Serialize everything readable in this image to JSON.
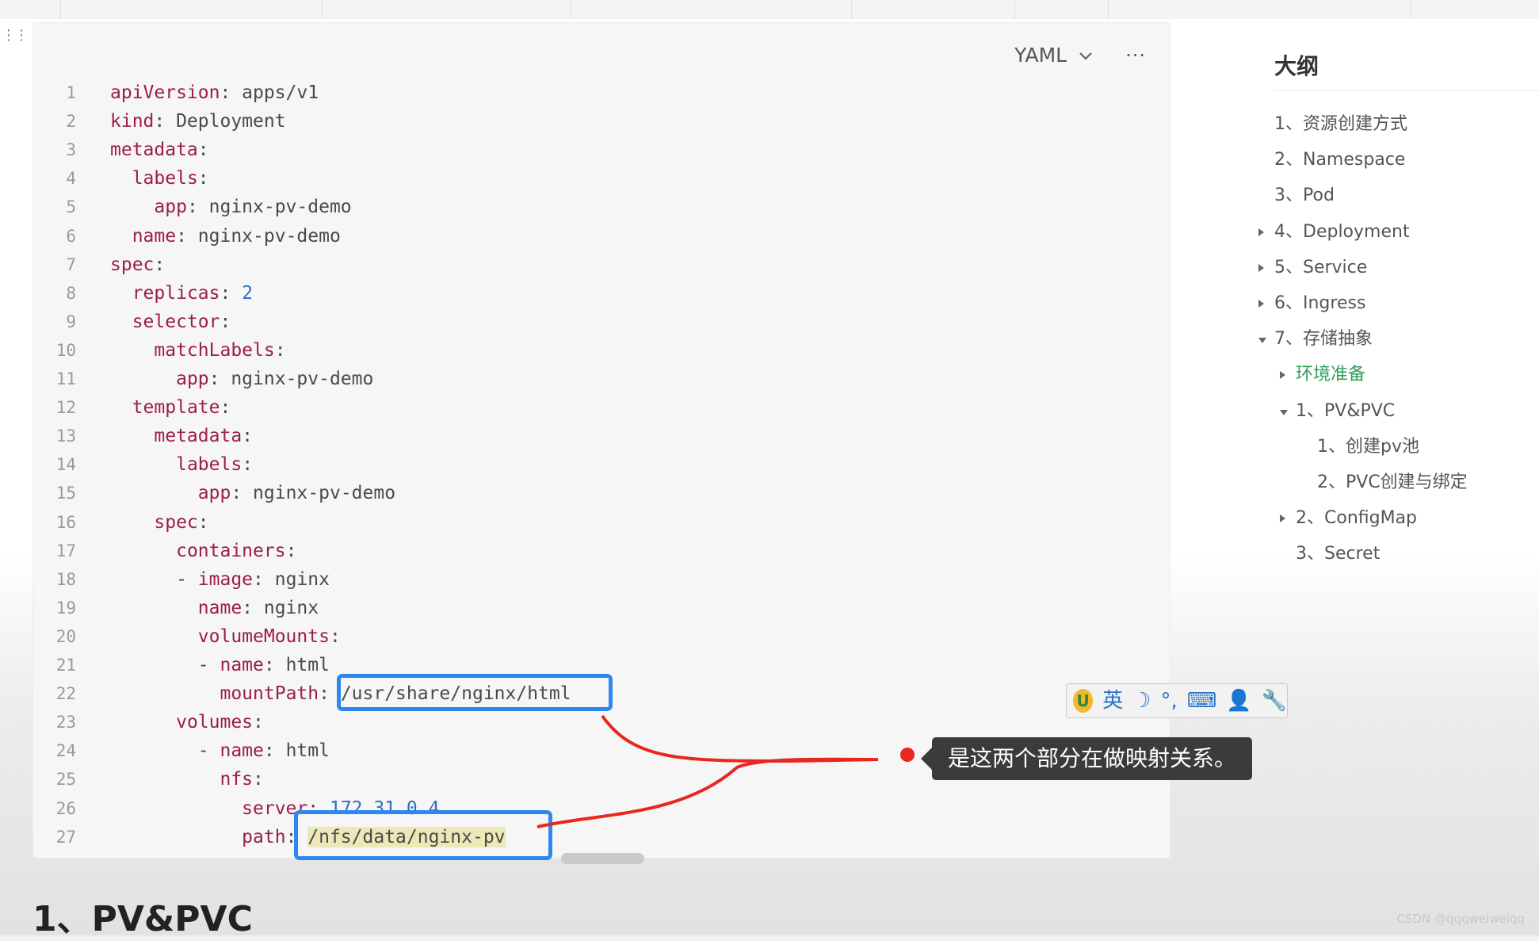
{
  "code_block": {
    "language": "YAML",
    "more_label": "···",
    "lines": [
      {
        "num": "1",
        "parts": [
          {
            "t": "k",
            "s": "apiVersion"
          },
          {
            "t": "v",
            "s": ": apps/v1"
          }
        ]
      },
      {
        "num": "2",
        "parts": [
          {
            "t": "k",
            "s": "kind"
          },
          {
            "t": "v",
            "s": ": Deployment"
          }
        ]
      },
      {
        "num": "3",
        "parts": [
          {
            "t": "k",
            "s": "metadata"
          },
          {
            "t": "v",
            "s": ":"
          }
        ]
      },
      {
        "num": "4",
        "parts": [
          {
            "t": "v",
            "s": "  "
          },
          {
            "t": "k",
            "s": "labels"
          },
          {
            "t": "v",
            "s": ":"
          }
        ]
      },
      {
        "num": "5",
        "parts": [
          {
            "t": "v",
            "s": "    "
          },
          {
            "t": "k",
            "s": "app"
          },
          {
            "t": "v",
            "s": ": nginx-pv-demo"
          }
        ]
      },
      {
        "num": "6",
        "parts": [
          {
            "t": "v",
            "s": "  "
          },
          {
            "t": "k",
            "s": "name"
          },
          {
            "t": "v",
            "s": ": nginx-pv-demo"
          }
        ]
      },
      {
        "num": "7",
        "parts": [
          {
            "t": "k",
            "s": "spec"
          },
          {
            "t": "v",
            "s": ":"
          }
        ]
      },
      {
        "num": "8",
        "parts": [
          {
            "t": "v",
            "s": "  "
          },
          {
            "t": "k",
            "s": "replicas"
          },
          {
            "t": "v",
            "s": ": "
          },
          {
            "t": "n",
            "s": "2"
          }
        ]
      },
      {
        "num": "9",
        "parts": [
          {
            "t": "v",
            "s": "  "
          },
          {
            "t": "k",
            "s": "selector"
          },
          {
            "t": "v",
            "s": ":"
          }
        ]
      },
      {
        "num": "10",
        "parts": [
          {
            "t": "v",
            "s": "    "
          },
          {
            "t": "k",
            "s": "matchLabels"
          },
          {
            "t": "v",
            "s": ":"
          }
        ]
      },
      {
        "num": "11",
        "parts": [
          {
            "t": "v",
            "s": "      "
          },
          {
            "t": "k",
            "s": "app"
          },
          {
            "t": "v",
            "s": ": nginx-pv-demo"
          }
        ]
      },
      {
        "num": "12",
        "parts": [
          {
            "t": "v",
            "s": "  "
          },
          {
            "t": "k",
            "s": "template"
          },
          {
            "t": "v",
            "s": ":"
          }
        ]
      },
      {
        "num": "13",
        "parts": [
          {
            "t": "v",
            "s": "    "
          },
          {
            "t": "k",
            "s": "metadata"
          },
          {
            "t": "v",
            "s": ":"
          }
        ]
      },
      {
        "num": "14",
        "parts": [
          {
            "t": "v",
            "s": "      "
          },
          {
            "t": "k",
            "s": "labels"
          },
          {
            "t": "v",
            "s": ":"
          }
        ]
      },
      {
        "num": "15",
        "parts": [
          {
            "t": "v",
            "s": "        "
          },
          {
            "t": "k",
            "s": "app"
          },
          {
            "t": "v",
            "s": ": nginx-pv-demo"
          }
        ]
      },
      {
        "num": "16",
        "parts": [
          {
            "t": "v",
            "s": "    "
          },
          {
            "t": "k",
            "s": "spec"
          },
          {
            "t": "v",
            "s": ":"
          }
        ]
      },
      {
        "num": "17",
        "parts": [
          {
            "t": "v",
            "s": "      "
          },
          {
            "t": "k",
            "s": "containers"
          },
          {
            "t": "v",
            "s": ":"
          }
        ]
      },
      {
        "num": "18",
        "parts": [
          {
            "t": "v",
            "s": "      - "
          },
          {
            "t": "k",
            "s": "image"
          },
          {
            "t": "v",
            "s": ": nginx"
          }
        ]
      },
      {
        "num": "19",
        "parts": [
          {
            "t": "v",
            "s": "        "
          },
          {
            "t": "k",
            "s": "name"
          },
          {
            "t": "v",
            "s": ": nginx"
          }
        ]
      },
      {
        "num": "20",
        "parts": [
          {
            "t": "v",
            "s": "        "
          },
          {
            "t": "k",
            "s": "volumeMounts"
          },
          {
            "t": "v",
            "s": ":"
          }
        ]
      },
      {
        "num": "21",
        "parts": [
          {
            "t": "v",
            "s": "        - "
          },
          {
            "t": "k",
            "s": "name"
          },
          {
            "t": "v",
            "s": ": html"
          }
        ]
      },
      {
        "num": "22",
        "parts": [
          {
            "t": "v",
            "s": "          "
          },
          {
            "t": "k",
            "s": "mountPath"
          },
          {
            "t": "v",
            "s": ": "
          },
          {
            "t": "v",
            "s": "/usr/share/nginx/html"
          }
        ]
      },
      {
        "num": "23",
        "parts": [
          {
            "t": "v",
            "s": "      "
          },
          {
            "t": "k",
            "s": "volumes"
          },
          {
            "t": "v",
            "s": ":"
          }
        ]
      },
      {
        "num": "24",
        "parts": [
          {
            "t": "v",
            "s": "        - "
          },
          {
            "t": "k",
            "s": "name"
          },
          {
            "t": "v",
            "s": ": html"
          }
        ]
      },
      {
        "num": "25",
        "parts": [
          {
            "t": "v",
            "s": "          "
          },
          {
            "t": "k",
            "s": "nfs"
          },
          {
            "t": "v",
            "s": ":"
          }
        ]
      },
      {
        "num": "26",
        "parts": [
          {
            "t": "v",
            "s": "            "
          },
          {
            "t": "k",
            "s": "server"
          },
          {
            "t": "v",
            "s": ": "
          },
          {
            "t": "n",
            "s": "172.31.0.4"
          }
        ]
      },
      {
        "num": "27",
        "parts": [
          {
            "t": "v",
            "s": "            "
          },
          {
            "t": "k",
            "s": "path"
          },
          {
            "t": "v",
            "s": ": "
          },
          {
            "t": "hl",
            "s": "/nfs/data/nginx-pv"
          }
        ]
      }
    ]
  },
  "annotation": {
    "tooltip": "是这两个部分在做映射关系。",
    "line_color": "#e8271e",
    "box_color": "#2e86f0"
  },
  "ime_toolbar": {
    "logo": "U",
    "items": [
      "英",
      "☽",
      "°,",
      "⌨",
      "👤",
      "🔧"
    ]
  },
  "outline": {
    "title": "大纲",
    "items": [
      {
        "label": "1、资源创建方式",
        "caret": "none"
      },
      {
        "label": "2、Namespace",
        "caret": "none"
      },
      {
        "label": "3、Pod",
        "caret": "none"
      },
      {
        "label": "4、Deployment",
        "caret": "right"
      },
      {
        "label": "5、Service",
        "caret": "right"
      },
      {
        "label": "6、Ingress",
        "caret": "right"
      },
      {
        "label": "7、存储抽象",
        "caret": "down"
      },
      {
        "label": "环境准备",
        "caret": "right",
        "active": true
      },
      {
        "label": "1、PV&PVC",
        "caret": "down"
      },
      {
        "label": "1、创建pv池",
        "caret": "none"
      },
      {
        "label": "2、PVC创建与绑定",
        "caret": "none"
      },
      {
        "label": "2、ConfigMap",
        "caret": "right"
      },
      {
        "label": "3、Secret",
        "caret": "none"
      }
    ]
  },
  "heading": "1、PV&PVC",
  "watermark": "CSDN @qqqweiweiqq",
  "colors": {
    "key": "#9c1d4e",
    "number": "#2c6fbf",
    "outline_active": "#2e9e5b"
  }
}
